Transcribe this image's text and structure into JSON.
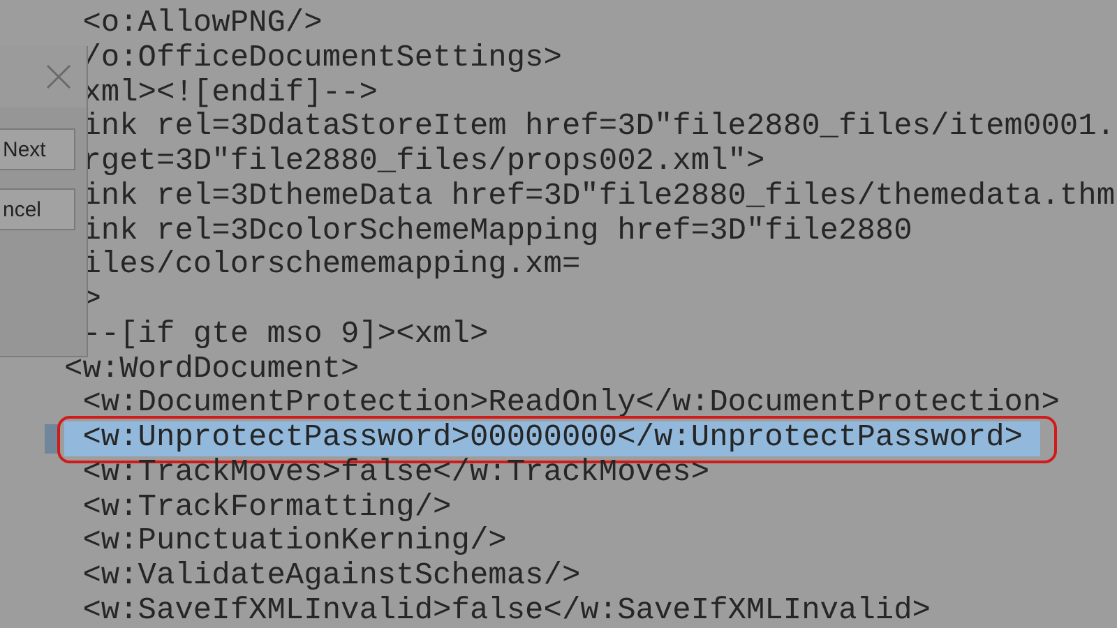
{
  "editor": {
    "lines": [
      {
        "text": " <o:AllowPNG/>",
        "selected": false,
        "circled": false
      },
      {
        "text": " /o:OfficeDocumentSettings>",
        "selected": false,
        "circled": false
      },
      {
        "text": " xml><![endif]-->",
        "selected": false,
        "circled": false
      },
      {
        "text": " ink rel=3DdataStoreItem href=3D\"file2880_files/item0001.",
        "selected": false,
        "circled": false
      },
      {
        "text": " rget=3D\"file2880_files/props002.xml\">",
        "selected": false,
        "circled": false
      },
      {
        "text": " ink rel=3DthemeData href=3D\"file2880_files/themedata.thm",
        "selected": false,
        "circled": false
      },
      {
        "text": " ink rel=3DcolorSchemeMapping href=3D\"file2880",
        "selected": false,
        "circled": false
      },
      {
        "text": " iles/colorschememapping.xm=",
        "selected": false,
        "circled": false
      },
      {
        "text": " >",
        "selected": false,
        "circled": false
      },
      {
        "text": " --[if gte mso 9]><xml>",
        "selected": false,
        "circled": false
      },
      {
        "text": "<w:WordDocument>",
        "selected": false,
        "circled": false
      },
      {
        "text": " <w:DocumentProtection>ReadOnly</w:DocumentProtection>",
        "selected": false,
        "circled": false
      },
      {
        "text": " <w:UnprotectPassword>00000000</w:UnprotectPassword>",
        "selected": true,
        "circled": true
      },
      {
        "text": " <w:TrackMoves>false</w:TrackMoves>",
        "selected": false,
        "circled": false
      },
      {
        "text": " <w:TrackFormatting/>",
        "selected": false,
        "circled": false
      },
      {
        "text": " <w:PunctuationKerning/>",
        "selected": false,
        "circled": false
      },
      {
        "text": " <w:ValidateAgainstSchemas/>",
        "selected": false,
        "circled": false
      },
      {
        "text": " <w:SaveIfXMLInvalid>false</w:SaveIfXMLInvalid>",
        "selected": false,
        "circled": false
      }
    ]
  },
  "dialog": {
    "buttons": [
      "Next",
      "ncel"
    ]
  }
}
